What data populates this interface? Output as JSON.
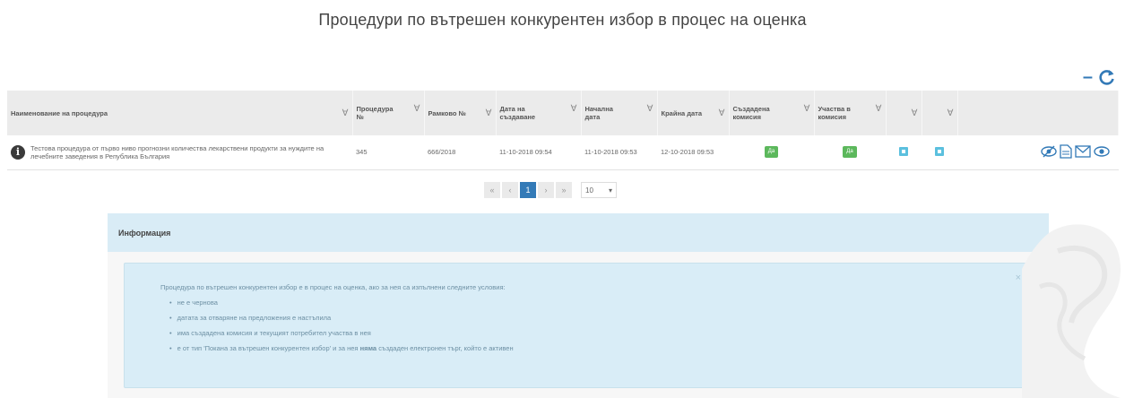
{
  "page": {
    "title": "Процедури по вътрешен конкурентен избор в процес на оценка"
  },
  "toolbar": {
    "collapse_symbol": "–",
    "refresh_icon": "refresh-icon"
  },
  "table": {
    "filter_symbol": "∀",
    "columns": [
      {
        "label": "Наименование на процедура",
        "filter": true
      },
      {
        "label": "Процедура №",
        "filter": true
      },
      {
        "label": "Рамково №",
        "filter": true
      },
      {
        "label": "Дата на създаване",
        "filter": true
      },
      {
        "label": "Начална дата",
        "filter": true
      },
      {
        "label": "Крайна дата",
        "filter": true
      },
      {
        "label": "Създадена комисия",
        "filter": true
      },
      {
        "label": "Участва в комисия",
        "filter": true
      },
      {
        "label": "",
        "filter": true
      },
      {
        "label": "",
        "filter": true
      },
      {
        "label": "",
        "filter": false
      }
    ],
    "rows": [
      {
        "name": "Тестова процедура от първо ниво прогнозни количества лекарствени продукти за нуждите на лечебните заведения в Република България",
        "procedure_no": "345",
        "framework_no": "666/2018",
        "created": "11-10-2018 09:54",
        "start": "11-10-2018 09:53",
        "end": "12-10-2018 09:53",
        "commission_created": "Да",
        "in_commission": "Да"
      }
    ]
  },
  "pager": {
    "first": "«",
    "prev": "‹",
    "current": "1",
    "next": "›",
    "last": "»",
    "page_size": "10",
    "page_size_caret": "▾"
  },
  "info": {
    "header": "Информация",
    "close": "×",
    "intro": "Процедура по вътрешен конкурентен избор е в процес на оценка, ако за нея са изпълнени следните условия:",
    "bullets": [
      "не е чернова",
      "датата за отваряне на предложения е настъпила",
      "има създадена комисия и текущият потребител участва в нея"
    ],
    "last_bullet_before": "е от тип 'Покана за вътрешен конкурентен избор' и за нея ",
    "last_bullet_bold": "няма",
    "last_bullet_after": " създаден електронен търг, който е активен"
  }
}
